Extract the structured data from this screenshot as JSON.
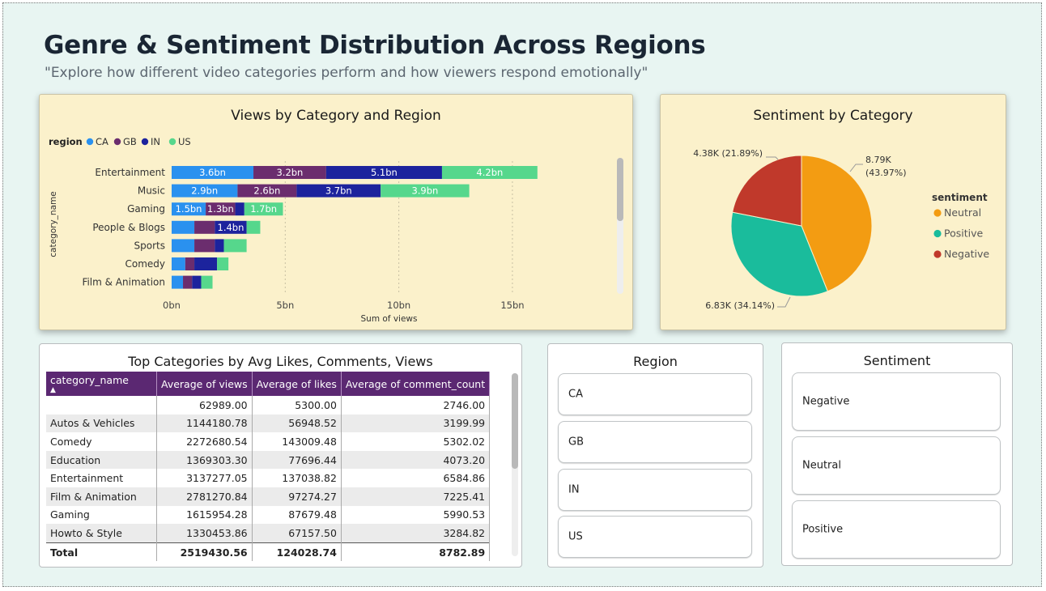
{
  "page": {
    "title": "Genre & Sentiment Distribution Across Regions",
    "subtitle": "\"Explore how different video categories perform and how viewers respond emotionally\""
  },
  "icons": {
    "sort": "sort-ascending-icon",
    "legend_marker": "circle"
  },
  "colors": {
    "CA": "#2a91ef",
    "GB": "#6b2d6e",
    "IN": "#1c239d",
    "US": "#56d78c",
    "Neutral": "#f39c12",
    "Positive": "#1abc9c",
    "Negative": "#c0392b",
    "header_purple": "#5b2872",
    "card_yellow": "#fbf1cb"
  },
  "bar_chart": {
    "title": "Views by Category and Region",
    "legend_title": "region",
    "y_axis_label": "category_name",
    "x_axis_label": "Sum of views"
  },
  "pie_chart": {
    "title": "Sentiment by Category",
    "legend_title": "sentiment"
  },
  "chart_data": [
    {
      "type": "bar",
      "orientation": "horizontal",
      "stacked": true,
      "title": "Views by Category and Region",
      "xlabel": "Sum of views",
      "ylabel": "category_name",
      "legend_title": "region",
      "legend_position": "top-left",
      "grid": true,
      "xlim": [
        0,
        16
      ],
      "unit": "bn",
      "x_ticks": [
        "0bn",
        "5bn",
        "10bn",
        "15bn"
      ],
      "categories": [
        "Entertainment",
        "Music",
        "Gaming",
        "People & Blogs",
        "Sports",
        "Comedy",
        "Film & Animation"
      ],
      "series": [
        {
          "name": "CA",
          "values": [
            3.6,
            2.9,
            1.5,
            1.0,
            1.0,
            0.6,
            0.5
          ],
          "labels": [
            "3.6bn",
            "2.9bn",
            "1.5bn",
            "",
            "",
            "",
            ""
          ]
        },
        {
          "name": "GB",
          "values": [
            3.2,
            2.6,
            1.3,
            0.9,
            0.9,
            0.4,
            0.4
          ],
          "labels": [
            "3.2bn",
            "2.6bn",
            "1.3bn",
            "",
            "",
            "",
            ""
          ]
        },
        {
          "name": "IN",
          "values": [
            5.1,
            3.7,
            0.4,
            1.4,
            0.4,
            1.0,
            0.4
          ],
          "labels": [
            "5.1bn",
            "3.7bn",
            "",
            "1.4bn",
            "",
            "",
            ""
          ]
        },
        {
          "name": "US",
          "values": [
            4.2,
            3.9,
            1.7,
            0.6,
            1.0,
            0.5,
            0.5
          ],
          "labels": [
            "4.2bn",
            "3.9bn",
            "1.7bn",
            "",
            "",
            "",
            ""
          ]
        }
      ]
    },
    {
      "type": "pie",
      "title": "Sentiment by Category",
      "legend_title": "sentiment",
      "legend_position": "right",
      "slices": [
        {
          "name": "Neutral",
          "value": 8790,
          "label": "8.79K\n(43.97%)",
          "percent": 43.97
        },
        {
          "name": "Positive",
          "value": 6830,
          "label": "6.83K (34.14%)",
          "percent": 34.14
        },
        {
          "name": "Negative",
          "value": 4380,
          "label": "4.38K (21.89%)",
          "percent": 21.89
        }
      ]
    }
  ],
  "table": {
    "title": "Top Categories by Avg Likes, Comments, Views",
    "columns": [
      "category_name",
      "Average of views",
      "Average of likes",
      "Average of comment_count"
    ],
    "rows": [
      [
        "",
        "62989.00",
        "5300.00",
        "2746.00"
      ],
      [
        "Autos & Vehicles",
        "1144180.78",
        "56948.52",
        "3199.99"
      ],
      [
        "Comedy",
        "2272680.54",
        "143009.48",
        "5302.02"
      ],
      [
        "Education",
        "1369303.30",
        "77696.44",
        "4073.20"
      ],
      [
        "Entertainment",
        "3137277.05",
        "137038.82",
        "6584.86"
      ],
      [
        "Film & Animation",
        "2781270.84",
        "97274.27",
        "7225.41"
      ],
      [
        "Gaming",
        "1615954.28",
        "87679.48",
        "5990.53"
      ],
      [
        "Howto & Style",
        "1330453.86",
        "67157.50",
        "3284.82"
      ]
    ],
    "total": [
      "Total",
      "2519430.56",
      "124028.74",
      "8782.89"
    ]
  },
  "region_slicer": {
    "title": "Region",
    "options": [
      "CA",
      "GB",
      "IN",
      "US"
    ]
  },
  "sentiment_slicer": {
    "title": "Sentiment",
    "options": [
      "Negative",
      "Neutral",
      "Positive"
    ]
  }
}
